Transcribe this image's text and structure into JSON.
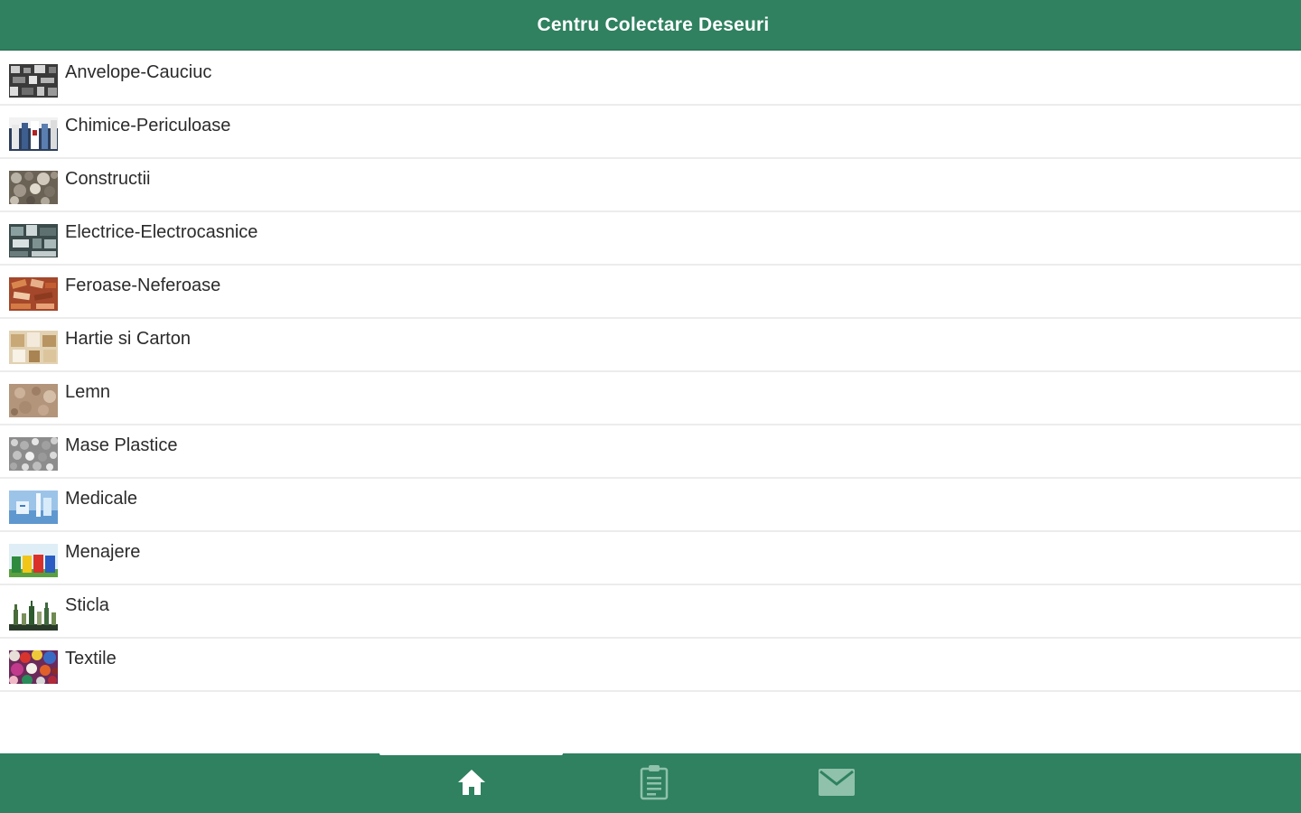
{
  "header": {
    "title": "Centru Colectare Deseuri"
  },
  "categories": [
    {
      "label": "Anvelope-Cauciuc",
      "icon": "tires-photo-icon"
    },
    {
      "label": "Chimice-Periculoase",
      "icon": "chemicals-photo-icon"
    },
    {
      "label": "Constructii",
      "icon": "construction-debris-photo-icon"
    },
    {
      "label": "Electrice-Electrocasnice",
      "icon": "electronics-photo-icon"
    },
    {
      "label": "Feroase-Neferoase",
      "icon": "metal-scrap-photo-icon"
    },
    {
      "label": "Hartie si Carton",
      "icon": "paper-cardboard-photo-icon"
    },
    {
      "label": "Lemn",
      "icon": "wood-photo-icon"
    },
    {
      "label": "Mase Plastice",
      "icon": "plastics-photo-icon"
    },
    {
      "label": "Medicale",
      "icon": "medical-photo-icon"
    },
    {
      "label": "Menajere",
      "icon": "household-bins-photo-icon"
    },
    {
      "label": "Sticla",
      "icon": "glass-bottles-photo-icon"
    },
    {
      "label": "Textile",
      "icon": "textiles-photo-icon"
    }
  ],
  "tabbar": {
    "tabs": [
      {
        "name": "home",
        "icon": "home-icon",
        "active": true
      },
      {
        "name": "list",
        "icon": "clipboard-icon",
        "active": false
      },
      {
        "name": "contact",
        "icon": "mail-icon",
        "active": false
      }
    ]
  },
  "colors": {
    "brand_green": "#2f8160",
    "divider": "#ececec",
    "text": "#2b2b2b",
    "tab_icon_active": "#ffffff",
    "tab_icon_inactive": "#8fc1ab"
  }
}
